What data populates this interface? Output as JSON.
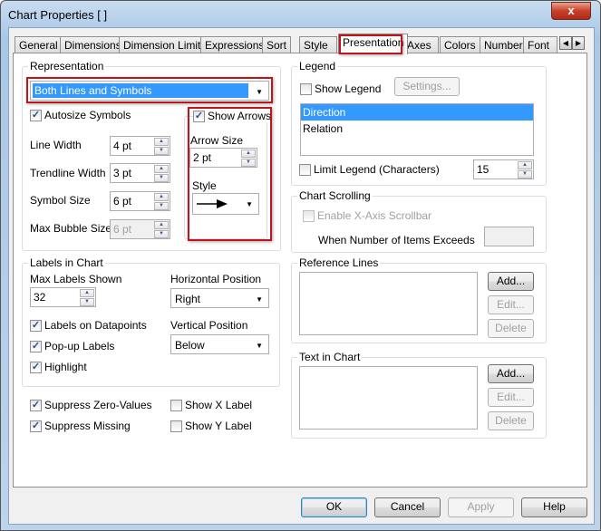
{
  "window": {
    "title": "Chart Properties [ ]",
    "close": "x"
  },
  "tabs": [
    "General",
    "Dimensions",
    "Dimension Limits",
    "Expressions",
    "Sort",
    "Style",
    "Presentation",
    "Axes",
    "Colors",
    "Number",
    "Font"
  ],
  "representation": {
    "label": "Representation",
    "value": "Both Lines and Symbols",
    "autosize": "Autosize Symbols",
    "line_width": {
      "label": "Line Width",
      "value": "4 pt"
    },
    "trendline_width": {
      "label": "Trendline Width",
      "value": "3 pt"
    },
    "symbol_size": {
      "label": "Symbol Size",
      "value": "6 pt"
    },
    "max_bubble": {
      "label": "Max Bubble Size",
      "value": "6 pt"
    },
    "show_arrows": "Show Arrows",
    "arrow_size": {
      "label": "Arrow Size",
      "value": "2 pt"
    },
    "style_label": "Style"
  },
  "labels": {
    "title": "Labels in Chart",
    "max_shown": {
      "label": "Max Labels Shown",
      "value": "32"
    },
    "horizontal": {
      "label": "Horizontal Position",
      "value": "Right"
    },
    "vertical": {
      "label": "Vertical Position",
      "value": "Below"
    },
    "on_datapoints": "Labels on Datapoints",
    "popup": "Pop-up Labels",
    "highlight": "Highlight"
  },
  "suppress_zero": "Suppress Zero-Values",
  "suppress_missing": "Suppress Missing",
  "show_x": "Show X Label",
  "show_y": "Show Y Label",
  "legend": {
    "title": "Legend",
    "show": "Show Legend",
    "settings": "Settings...",
    "items": [
      "Direction",
      "Relation"
    ],
    "limit": "Limit Legend (Characters)",
    "limit_value": "15"
  },
  "scrolling": {
    "title": "Chart Scrolling",
    "enable": "Enable X-Axis Scrollbar",
    "exceeds": "When Number of Items Exceeds"
  },
  "reference": {
    "title": "Reference Lines",
    "add": "Add...",
    "edit": "Edit...",
    "delete": "Delete"
  },
  "text_in_chart": {
    "title": "Text in Chart",
    "add": "Add...",
    "edit": "Edit...",
    "delete": "Delete"
  },
  "footer": {
    "ok": "OK",
    "cancel": "Cancel",
    "apply": "Apply",
    "help": "Help"
  }
}
